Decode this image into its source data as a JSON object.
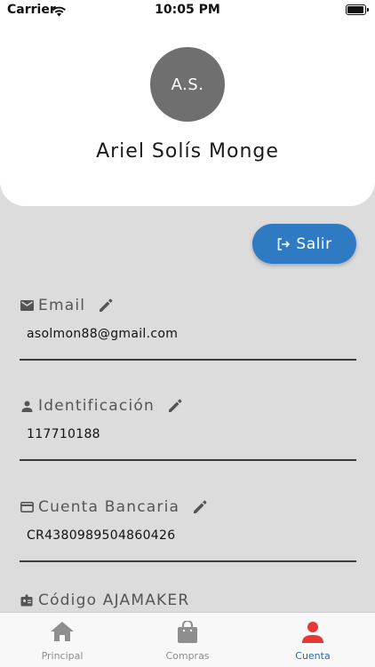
{
  "status_bar": {
    "carrier": "Carrier",
    "time": "10:05 PM"
  },
  "profile": {
    "initials": "A.S.",
    "name": "Ariel Solís Monge"
  },
  "logout_label": "Salir",
  "fields": [
    {
      "label": "Email",
      "value": "asolmon88@gmail.com",
      "icon": "mail-icon"
    },
    {
      "label": "Identificación",
      "value": "117710188",
      "icon": "person-icon"
    },
    {
      "label": "Cuenta Bancaria",
      "value": "CR4380989504860426",
      "icon": "credit-card-icon"
    },
    {
      "label": "Código AJAMAKER",
      "icon": "badge-icon"
    }
  ],
  "tabs": [
    {
      "label": "Principal",
      "icon": "home-icon"
    },
    {
      "label": "Compras",
      "icon": "shopping-bag-icon"
    },
    {
      "label": "Cuenta",
      "icon": "account-icon",
      "active": true
    }
  ],
  "colors": {
    "accent": "#2e7bc4",
    "active_tab_icon": "#e53935",
    "avatar": "#6f6f6f"
  }
}
